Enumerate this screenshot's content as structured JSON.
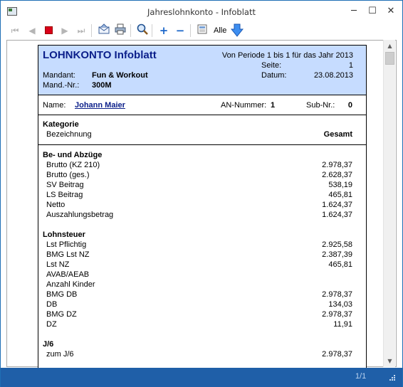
{
  "window": {
    "title": "Jahreslohnkonto - Infoblatt",
    "minimize_glyph": "─",
    "maximize_glyph": "☐",
    "close_glyph": "✕"
  },
  "toolbar": {
    "first_glyph": "⏮",
    "prev_glyph": "◀",
    "next_glyph": "▶",
    "last_glyph": "⏭",
    "plus_glyph": "+",
    "minus_glyph": "−",
    "alle_label": "Alle",
    "icons": [
      "first-page-icon",
      "previous-page-icon",
      "stop-icon",
      "next-page-icon",
      "last-page-icon",
      "envelope-icon",
      "printer-icon",
      "zoom-icon",
      "zoom-in-icon",
      "zoom-out-icon",
      "page-view-icon",
      "download-arrow-icon"
    ],
    "accent_color": "#1b66c9",
    "stop_color": "#d9001a"
  },
  "report": {
    "title": "LOHNKONTO Infoblatt",
    "period": "Von Periode 1 bis 1 für das Jahr 2013",
    "page_label": "Seite:",
    "page_value": "1",
    "date_label": "Datum:",
    "date_value": "23.08.2013",
    "mandant_label": "Mandant:",
    "mandant_value": "Fun & Workout",
    "mandnr_label": "Mand.-Nr.:",
    "mandnr_value": "300M",
    "header_color": "#c6dcff",
    "title_color": "#0b1f8a"
  },
  "employee": {
    "name_label": "Name:",
    "name_value": "Johann Maier",
    "an_label": "AN-Nummer:",
    "an_value": "1",
    "sub_label": "Sub-Nr.:",
    "sub_value": "0"
  },
  "columns": {
    "category": "Kategorie",
    "description": "Bezeichnung",
    "total": "Gesamt"
  },
  "sections": [
    {
      "title": "Be- und Abzüge",
      "rows": [
        {
          "label": "Brutto (KZ 210)",
          "value": "2.978,37"
        },
        {
          "label": "Brutto (ges.)",
          "value": "2.628,37"
        },
        {
          "label": "SV Beitrag",
          "value": "538,19"
        },
        {
          "label": "LS Beitrag",
          "value": "465,81"
        },
        {
          "label": "Netto",
          "value": "1.624,37"
        },
        {
          "label": "Auszahlungsbetrag",
          "value": "1.624,37"
        }
      ]
    },
    {
      "title": "Lohnsteuer",
      "rows": [
        {
          "label": "Lst Pflichtig",
          "value": "2.925,58"
        },
        {
          "label": "BMG Lst NZ",
          "value": "2.387,39"
        },
        {
          "label": "Lst NZ",
          "value": "465,81"
        },
        {
          "label": "AVAB/AEAB",
          "value": ""
        },
        {
          "label": "Anzahl Kinder",
          "value": ""
        },
        {
          "label": "BMG DB",
          "value": "2.978,37"
        },
        {
          "label": "DB",
          "value": "134,03"
        },
        {
          "label": "BMG DZ",
          "value": "2.978,37"
        },
        {
          "label": "DZ",
          "value": "11,91"
        }
      ]
    },
    {
      "title": "J/6",
      "rows": [
        {
          "label": "zum J/6",
          "value": "2.978,37"
        }
      ]
    }
  ],
  "scrollbar": {
    "up_glyph": "▲",
    "down_glyph": "▼"
  },
  "status": {
    "page_indicator": "1/1",
    "bar_color": "#1f5fa8"
  }
}
